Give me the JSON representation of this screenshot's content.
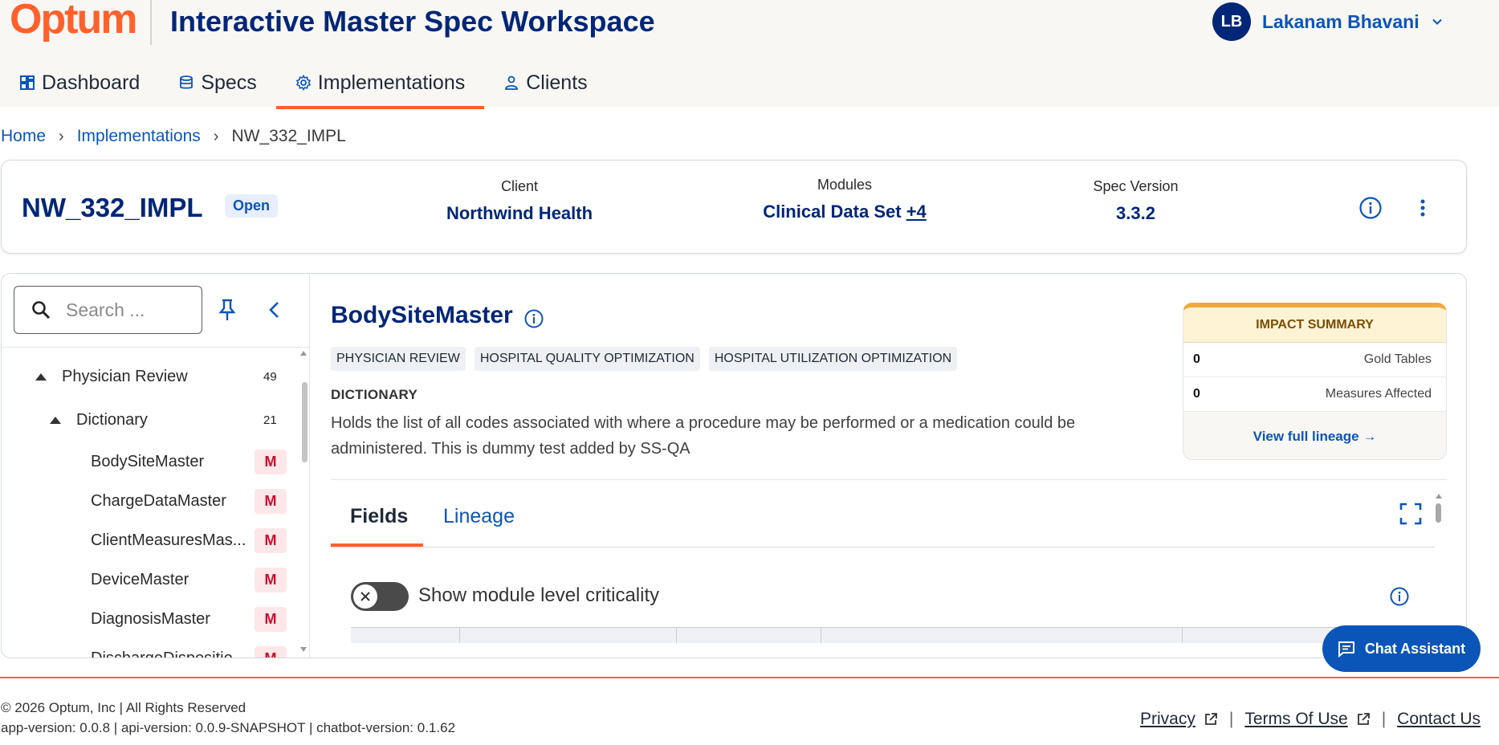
{
  "brand": {
    "logo": "Optum",
    "app_title": "Interactive Master Spec Workspace"
  },
  "user": {
    "initials": "LB",
    "name": "Lakanam Bhavani"
  },
  "nav": {
    "tabs": [
      {
        "label": "Dashboard",
        "icon": "dashboard-icon"
      },
      {
        "label": "Specs",
        "icon": "database-icon"
      },
      {
        "label": "Implementations",
        "icon": "gear-icon",
        "active": true
      },
      {
        "label": "Clients",
        "icon": "person-icon"
      }
    ]
  },
  "breadcrumb": {
    "home": "Home",
    "section": "Implementations",
    "current": "NW_332_IMPL"
  },
  "implementation": {
    "name": "NW_332_IMPL",
    "status": "Open",
    "client_label": "Client",
    "client_value": "Northwind Health",
    "modules_label": "Modules",
    "modules_value": "Clinical Data Set",
    "modules_more": "+4",
    "spec_label": "Spec Version",
    "spec_value": "3.3.2"
  },
  "sidebar": {
    "search_placeholder": "Search ...",
    "tree": [
      {
        "label": "Physician Review",
        "count": "49",
        "level": 0
      },
      {
        "label": "Dictionary",
        "count": "21",
        "level": 1
      },
      {
        "label": "BodySiteMaster",
        "badge": "M",
        "level": 2
      },
      {
        "label": "ChargeDataMaster",
        "badge": "M",
        "level": 2
      },
      {
        "label": "ClientMeasuresMas...",
        "badge": "M",
        "level": 2
      },
      {
        "label": "DeviceMaster",
        "badge": "M",
        "level": 2
      },
      {
        "label": "DiagnosisMaster",
        "badge": "M",
        "level": 2
      },
      {
        "label": "DischargeDispositio...",
        "badge": "M",
        "level": 2
      }
    ]
  },
  "detail": {
    "title": "BodySiteMaster",
    "tags": [
      "PHYSICIAN REVIEW",
      "HOSPITAL QUALITY OPTIMIZATION",
      "HOSPITAL UTILIZATION OPTIMIZATION"
    ],
    "section_label": "DICTIONARY",
    "description": "Holds the list of all codes associated with where a procedure may be performed or a medication could be administered. This is dummy test added by SS-QA",
    "tabs": {
      "fields": "Fields",
      "lineage": "Lineage"
    },
    "toggle_label": "Show module level criticality",
    "toggle_on": false
  },
  "impact": {
    "title": "IMPACT SUMMARY",
    "gold_tables_count": "0",
    "gold_tables_label": "Gold Tables",
    "measures_count": "0",
    "measures_label": "Measures Affected",
    "link": "View full lineage →"
  },
  "chat": {
    "label": "Chat Assistant"
  },
  "footer": {
    "copyright": "© 2026 Optum, Inc | All Rights Reserved",
    "versions": "app-version: 0.0.8 | api-version: 0.0.9-SNAPSHOT | chatbot-version: 0.1.62",
    "privacy": "Privacy",
    "terms": "Terms Of Use",
    "contact": "Contact Us"
  },
  "colors": {
    "brand_orange": "#ff612b",
    "navy": "#002677",
    "link_blue": "#0c55b8",
    "badge_red": "#c8102e"
  }
}
